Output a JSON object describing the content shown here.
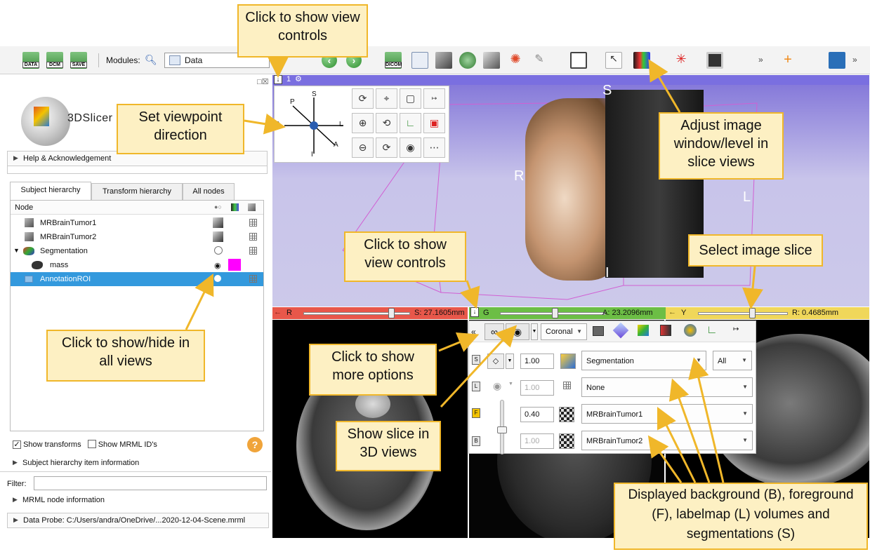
{
  "toolbar": {
    "icons": [
      {
        "name": "load-data-icon",
        "label": "DATA"
      },
      {
        "name": "dicom-icon",
        "label": "DCM"
      },
      {
        "name": "save-icon",
        "label": "SAVE"
      }
    ],
    "modules_label": "Modules:",
    "module_selected": "Data",
    "dicom_icon_label": "DICOM"
  },
  "app": {
    "logo_text": "3DSlicer"
  },
  "left_panel": {
    "help_section": "Help & Acknowledgement",
    "tabs": [
      "Subject hierarchy",
      "Transform hierarchy",
      "All nodes"
    ],
    "tree_header": "Node",
    "tree_items": [
      {
        "label": "MRBrainTumor1",
        "type": "volume"
      },
      {
        "label": "MRBrainTumor2",
        "type": "volume"
      },
      {
        "label": "Segmentation",
        "type": "segmentation"
      },
      {
        "label": "mass",
        "type": "segment",
        "color": "#ff00ff"
      },
      {
        "label": "AnnotationROI",
        "type": "roi",
        "selected": true
      }
    ],
    "show_transforms": "Show transforms",
    "show_mrml_ids": "Show MRML ID's",
    "item_info_section": "Subject hierarchy item information",
    "filter_label": "Filter:",
    "mrml_node_info": "MRML node information",
    "data_probe": "Data Probe: C:/Users/andra/OneDrive/...2020-12-04-Scene.mrml"
  },
  "view3d": {
    "header_number": "1",
    "orientation_labels": {
      "S": "S",
      "P": "P",
      "R": "R",
      "L": "L",
      "A": "A",
      "I": "I"
    },
    "scene_labels": {
      "S": "S",
      "R": "R",
      "L": "L",
      "I": "I"
    }
  },
  "slice_bars": {
    "red": {
      "letter": "R",
      "value": "S: 27.1605mm",
      "color": "#e8574a",
      "position": 0.82
    },
    "green": {
      "letter": "G",
      "value": "A: 23.2096mm",
      "color": "#6cbe45",
      "position": 0.52
    },
    "yellow": {
      "letter": "Y",
      "value": "R: 0.4685mm",
      "color": "#f0d75a",
      "position": 0.6
    }
  },
  "slice_controls": {
    "orientation": "Coronal",
    "layers": [
      {
        "layer": "S",
        "opacity": "1.00",
        "volume": "Segmentation",
        "extra": "All"
      },
      {
        "layer": "L",
        "opacity": "1.00",
        "volume": "None"
      },
      {
        "layer": "F",
        "opacity": "0.40",
        "volume": "MRBrainTumor1"
      },
      {
        "layer": "B",
        "opacity": "1.00",
        "volume": "MRBrainTumor2"
      }
    ]
  },
  "callouts": {
    "view_controls_top": "Click to show view controls",
    "viewpoint": "Set viewpoint direction",
    "window_level": "Adjust image window/level in slice views",
    "view_controls_mid": "Click to show view controls",
    "select_slice": "Select image slice",
    "show_hide": "Click to show/hide in all views",
    "more_options": "Click to show more options",
    "slice_3d": "Show slice in 3D views",
    "displayed": "Displayed background (B), foreground (F), labelmap (L) volumes and segmentations (S)"
  },
  "colors": {
    "callout_fill": "#fdf0c3",
    "callout_border": "#f0b72a",
    "arrow": "#f0b72a",
    "selection": "#3399dd",
    "view3d_bar": "#7a6fe0"
  }
}
